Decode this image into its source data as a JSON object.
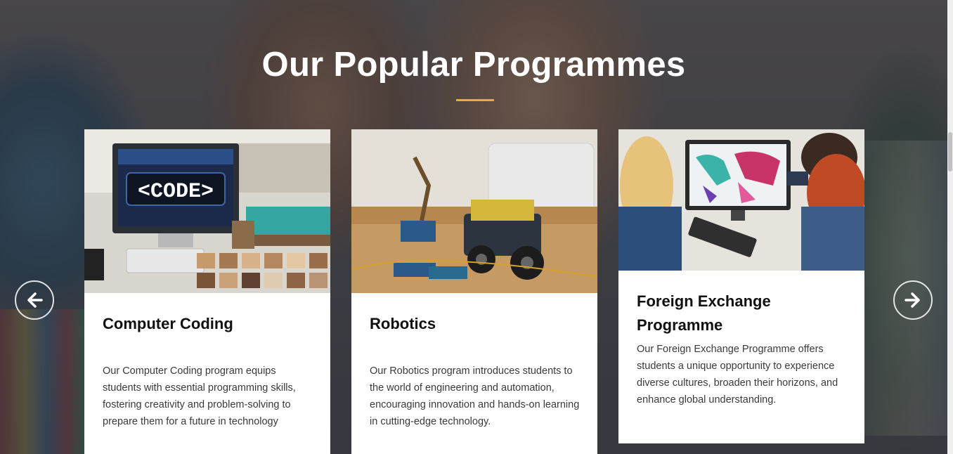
{
  "section": {
    "title": "Our Popular Programmes",
    "accent_color": "#e3b22a"
  },
  "cards": [
    {
      "title": "Computer Coding",
      "description": "Our Computer Coding program equips students with essential programming skills, fostering creativity and problem-solving to prepare them for a future in technology",
      "image_text": "<CODE>"
    },
    {
      "title": "Robotics",
      "description": "Our Robotics program introduces students to the world of engineering and automation, encouraging innovation and hands-on learning in cutting-edge technology."
    },
    {
      "title": "Foreign Exchange Programme",
      "description": "Our Foreign Exchange Programme offers students a unique opportunity to experience diverse cultures, broaden their horizons, and enhance global understanding."
    }
  ],
  "nav": {
    "prev_icon": "arrow-left-icon",
    "next_icon": "arrow-right-icon"
  }
}
